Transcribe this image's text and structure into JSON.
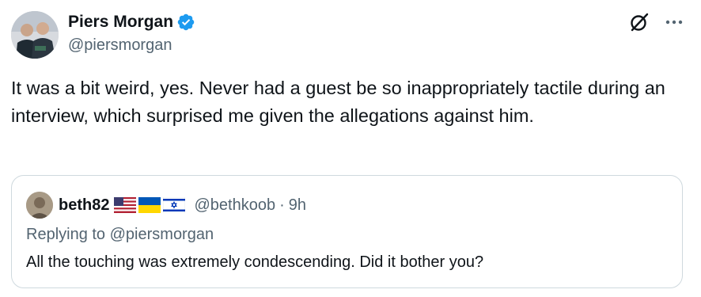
{
  "author": {
    "display_name": "Piers Morgan",
    "handle": "@piersmorgan",
    "verified": true,
    "verified_color": "#1d9bf0",
    "avatar_icon": "avatar-photo"
  },
  "header_actions": {
    "grok_icon": "grok-icon",
    "more_icon": "more-icon"
  },
  "tweet": {
    "text": "It was a bit weird, yes. Never had a guest be so inappropriately tactile during an interview, which surprised me given the allegations against him."
  },
  "quoted": {
    "display_name": "beth82",
    "flags": [
      "us-flag-icon",
      "ukraine-flag-icon",
      "israel-flag-icon"
    ],
    "handle": "@bethkoob",
    "separator": "·",
    "time": "9h",
    "replying_prefix": "Replying to",
    "replying_to": "@piersmorgan",
    "text": "All the touching was extremely condescending. Did it bother you?"
  }
}
